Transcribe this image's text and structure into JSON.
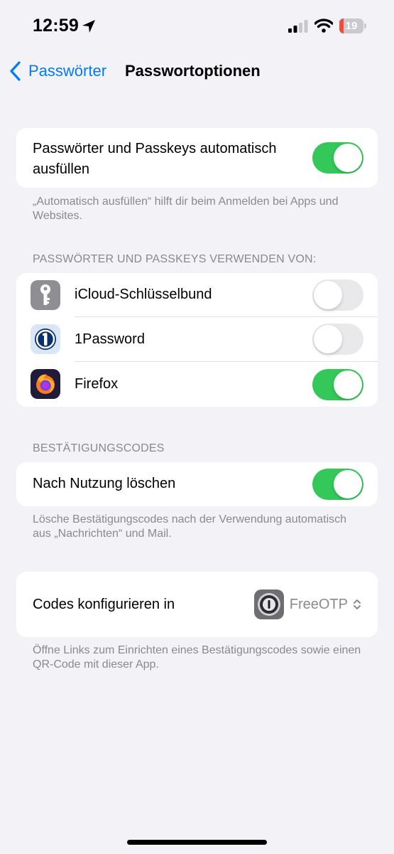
{
  "status_bar": {
    "time": "12:59",
    "battery_level": "19",
    "battery_fraction": 0.19,
    "battery_color": "#eb4e3d"
  },
  "nav": {
    "back_label": "Passwörter",
    "title": "Passwortoptionen"
  },
  "autofill": {
    "label": "Passwörter und Passkeys automatisch ausfüllen",
    "enabled": true,
    "footer": "„Automatisch ausfüllen“ hilft dir beim Anmelden bei Apps und Websites."
  },
  "providers": {
    "header": "PASSWÖRTER UND PASSKEYS VERWENDEN VON:",
    "items": [
      {
        "name": "iCloud-Schlüsselbund",
        "icon": "key-icon",
        "enabled": false
      },
      {
        "name": "1Password",
        "icon": "1password-icon",
        "enabled": false
      },
      {
        "name": "Firefox",
        "icon": "firefox-icon",
        "enabled": true
      }
    ]
  },
  "verification": {
    "header": "BESTÄTIGUNGSCODES",
    "delete_label": "Nach Nutzung löschen",
    "delete_enabled": true,
    "footer": "Lösche Bestätigungscodes nach der Verwendung automatisch aus „Nachrichten“ und Mail."
  },
  "codes": {
    "label": "Codes konfigurieren in",
    "app": "FreeOTP",
    "app_icon": "freeotp-icon",
    "footer": "Öffne Links zum Einrichten eines Bestätigungscodes sowie einen QR-Code mit dieser App."
  },
  "colors": {
    "accent": "#007aff",
    "toggle_on": "#34c759",
    "toggle_off": "#e9e9eb",
    "background": "#f2f2f7",
    "secondary_text": "#8a8a8e"
  }
}
